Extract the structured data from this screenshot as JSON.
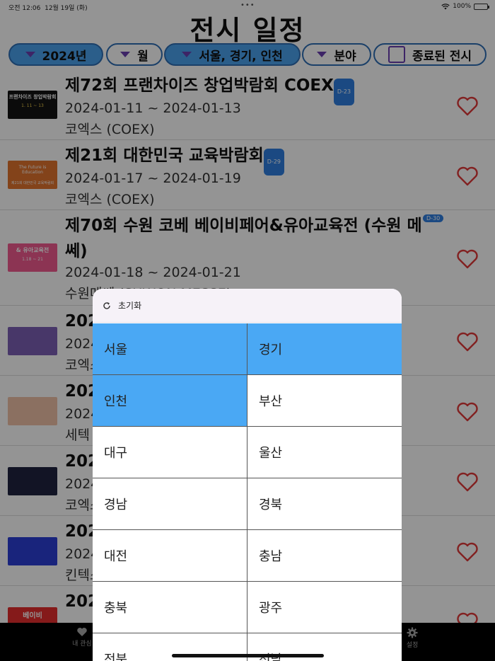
{
  "status": {
    "time": "오전 12:06",
    "date": "12월 19일 (화)",
    "dots": "•••",
    "battery": "100%"
  },
  "title": "전시 일정",
  "filters": {
    "year": "2024년",
    "month": "월",
    "region": "서울, 경기, 인천",
    "field": "분야",
    "ended": "종료된 전시",
    "colors": {
      "active": "#4aa3ee",
      "border": "#2f6fb5",
      "triangle": "#6a3fb0"
    }
  },
  "list": [
    {
      "title": "제72회 프랜차이즈 창업박람회 COEX",
      "dday": "D-23",
      "date": "2024-01-11 ~ 2024-01-13",
      "place": "코엑스 (COEX)",
      "thumb_text": "프랜차이즈 창업박람회",
      "thumb_sub": "1. 11 ~ 13"
    },
    {
      "title": "제21회 대한민국 교육박람회",
      "dday": "D-29",
      "date": "2024-01-17 ~ 2024-01-19",
      "place": "코엑스 (COEX)",
      "thumb_text": "The Future is Education",
      "thumb_sub": "제21회 대한민국 교육박람회"
    },
    {
      "title": "제70회 수원 코베 베이비페어&유아교육전 (수원 메쎄)",
      "dday": "D-30",
      "date": "2024-01-18 ~ 2024-01-21",
      "place": "수원메쎄 (SUWON MESSE)",
      "thumb_text": "& 유아교육전",
      "thumb_sub": "1.18 ~ 21"
    },
    {
      "title": "202",
      "date": "2024",
      "place": "코엑스"
    },
    {
      "title": "202",
      "date": "2024",
      "place": "세텍"
    },
    {
      "title": "202",
      "date": "2024",
      "place": "코엑스"
    },
    {
      "title": "202",
      "date": "2024",
      "place": "킨텍스"
    },
    {
      "title": "202",
      "date": "",
      "place": "",
      "thumb_text": "베이비"
    }
  ],
  "popup": {
    "reset_label": "초기화",
    "regions": [
      {
        "name": "서울",
        "selected": true
      },
      {
        "name": "경기",
        "selected": true
      },
      {
        "name": "인천",
        "selected": true
      },
      {
        "name": "부산",
        "selected": false
      },
      {
        "name": "대구",
        "selected": false
      },
      {
        "name": "울산",
        "selected": false
      },
      {
        "name": "경남",
        "selected": false
      },
      {
        "name": "경북",
        "selected": false
      },
      {
        "name": "대전",
        "selected": false
      },
      {
        "name": "충남",
        "selected": false
      },
      {
        "name": "충북",
        "selected": false
      },
      {
        "name": "광주",
        "selected": false
      },
      {
        "name": "전북",
        "selected": false
      },
      {
        "name": "전남",
        "selected": false
      }
    ],
    "selected_color": "#4aa8f4"
  },
  "tabbar": {
    "left_label": "내 관심",
    "right_label": "설정"
  }
}
